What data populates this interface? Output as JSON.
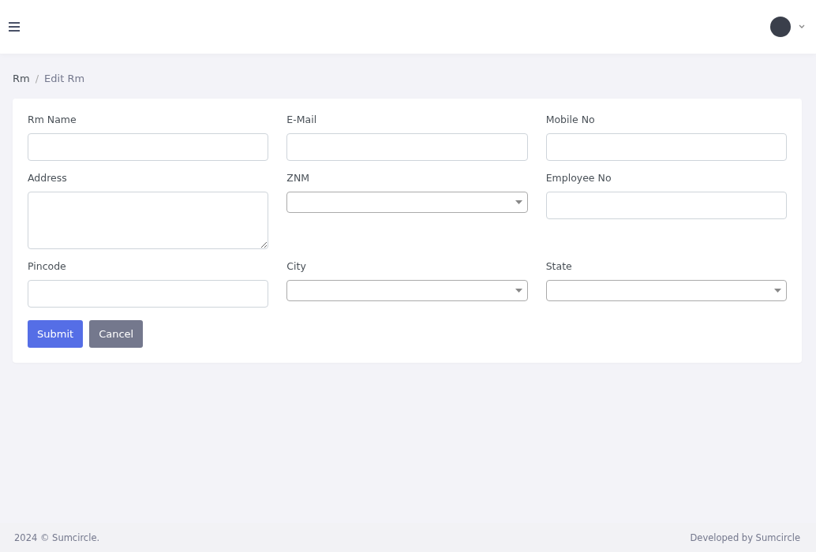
{
  "breadcrumb_separator": "/",
  "breadcrumb": [
    {
      "label": "Rm",
      "selected": false
    },
    {
      "label": "Edit Rm",
      "selected": true
    }
  ],
  "fields": [
    {
      "label": "Rm Name",
      "kind": "input"
    },
    {
      "label": "E-Mail",
      "kind": "input"
    },
    {
      "label": "Mobile No",
      "kind": "input"
    },
    {
      "label": "Address",
      "kind": "textarea"
    },
    {
      "label": "ZNM",
      "kind": "select"
    },
    {
      "label": "Employee No",
      "kind": "input"
    },
    {
      "label": "Pincode",
      "kind": "input"
    },
    {
      "label": "City",
      "kind": "select"
    },
    {
      "label": "State",
      "kind": "select"
    }
  ],
  "buttons": [
    {
      "label": "Submit",
      "kind": "primary"
    },
    {
      "label": "Cancel",
      "kind": "secondary"
    }
  ],
  "footer": {
    "left": "2024 © Sumcircle.",
    "right": "Developed by Sumcircle"
  }
}
